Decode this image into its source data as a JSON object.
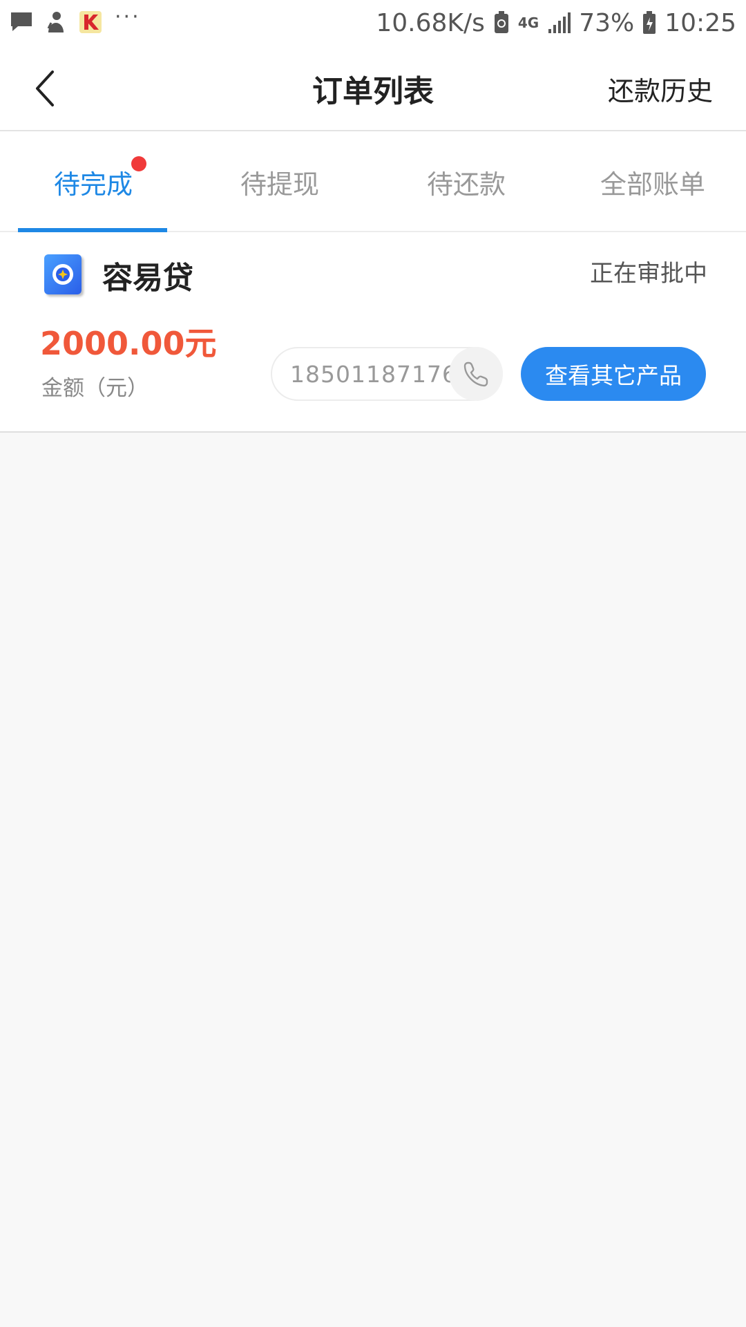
{
  "status_bar": {
    "network_speed": "10.68K/s",
    "network_type": "4G",
    "battery": "73%",
    "time": "10:25",
    "more": "···",
    "icons": [
      "message-icon",
      "user-icon",
      "app-icon",
      "battery-saver-icon",
      "signal-icon",
      "battery-icon"
    ]
  },
  "header": {
    "title": "订单列表",
    "action": "还款历史"
  },
  "tabs": [
    {
      "label": "待完成",
      "active": true,
      "badge": true
    },
    {
      "label": "待提现",
      "active": false
    },
    {
      "label": "待还款",
      "active": false
    },
    {
      "label": "全部账单",
      "active": false
    }
  ],
  "order": {
    "product_name": "容易贷",
    "status": "正在审批中",
    "amount": "2000.00元",
    "amount_label": "金额（元）",
    "phone": "18501187176",
    "button": "查看其它产品"
  },
  "colors": {
    "accent": "#1e88e5",
    "amount": "#f0583a",
    "badge": "#f03a3a",
    "button": "#2b8af0"
  }
}
